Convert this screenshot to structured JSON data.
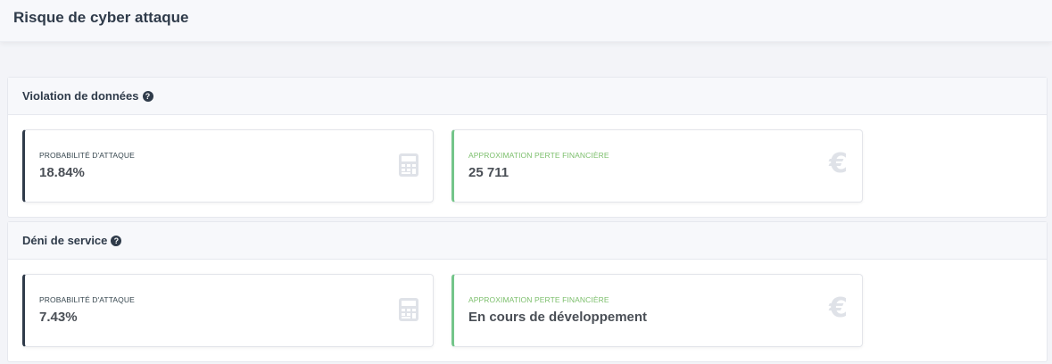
{
  "header": {
    "title": "Risque de cyber attaque"
  },
  "sections": [
    {
      "title": "Violation de données",
      "help_icon": "?",
      "probability": {
        "label": "PROBABILITÉ D'ATTAQUE",
        "value": "18.84%",
        "icon": "calculator-icon"
      },
      "loss": {
        "label": "APPROXIMATION PERTE FINANCIÈRE",
        "value": "25 711",
        "icon": "euro-icon",
        "icon_glyph": "€"
      }
    },
    {
      "title": "Déni de service",
      "help_icon": "?",
      "probability": {
        "label": "PROBABILITÉ D'ATTAQUE",
        "value": "7.43%",
        "icon": "calculator-icon"
      },
      "loss": {
        "label": "APPROXIMATION PERTE FINANCIÈRE",
        "value": "En cours de développement",
        "icon": "euro-icon",
        "icon_glyph": "€"
      }
    }
  ],
  "colors": {
    "accent_dark": "#2f3b4a",
    "accent_green": "#74c58a",
    "label_green": "#7cbf6c"
  }
}
